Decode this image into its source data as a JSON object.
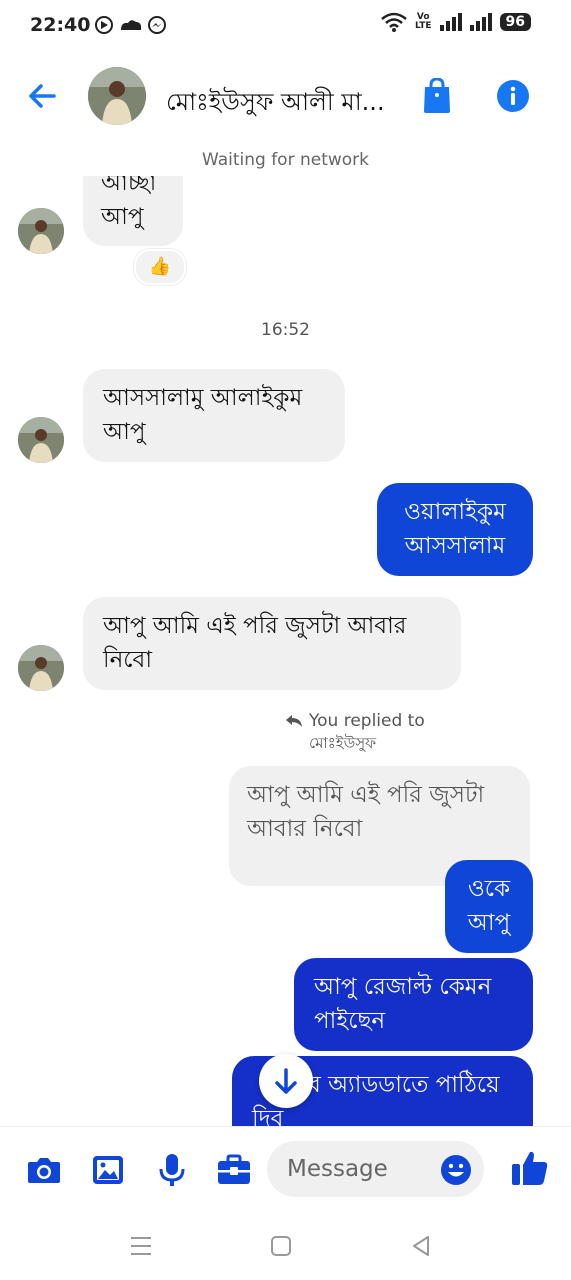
{
  "status_bar": {
    "time": "22:40",
    "network_label_top": "Vo",
    "network_label_bottom": "LTE",
    "battery": "96"
  },
  "header": {
    "title": "মোঃইউসুফ আলী মা...",
    "back_icon": "back-arrow-icon",
    "shop_icon": "bag-icon",
    "info_icon": "info-icon"
  },
  "network_status": "Waiting for network",
  "messages": {
    "m1_text": "আচ্ছা আপু",
    "m1_reaction": "👍",
    "timestamp": "16:52",
    "m2_line1": "আসসালামু আলাইকুম",
    "m2_line2": "আপু",
    "m3_line1": "ওয়ালাইকুম",
    "m3_line2": "আসসালাম",
    "m4_line1": "আপু আমি  এই পরি জুসটা আবার",
    "m4_line2": "নিবো",
    "reply_label": "You replied to",
    "reply_name": "মোঃইউসুফ",
    "quoted_line1": "আপু আমি  এই পরি জুসটা",
    "quoted_line2": "আবার নিবো",
    "m5_line1": "ওকে",
    "m5_line2": "আপু",
    "m6_line1": "আপু রেজাল্ট কেমন",
    "m6_line2": "পাইছেন",
    "m7_line1": "ব অ্যাডডাতে পাঠিয়ে",
    "m7_line2": "দিব"
  },
  "composer": {
    "placeholder": "Message",
    "icons": [
      "camera-icon",
      "gallery-icon",
      "microphone-icon",
      "briefcase-icon",
      "emoji-icon",
      "thumbs-up-icon"
    ]
  },
  "colors": {
    "accent": "#1877f2",
    "outgoing_bubble": "#1046d8",
    "incoming_bubble": "#f0f0f0"
  }
}
